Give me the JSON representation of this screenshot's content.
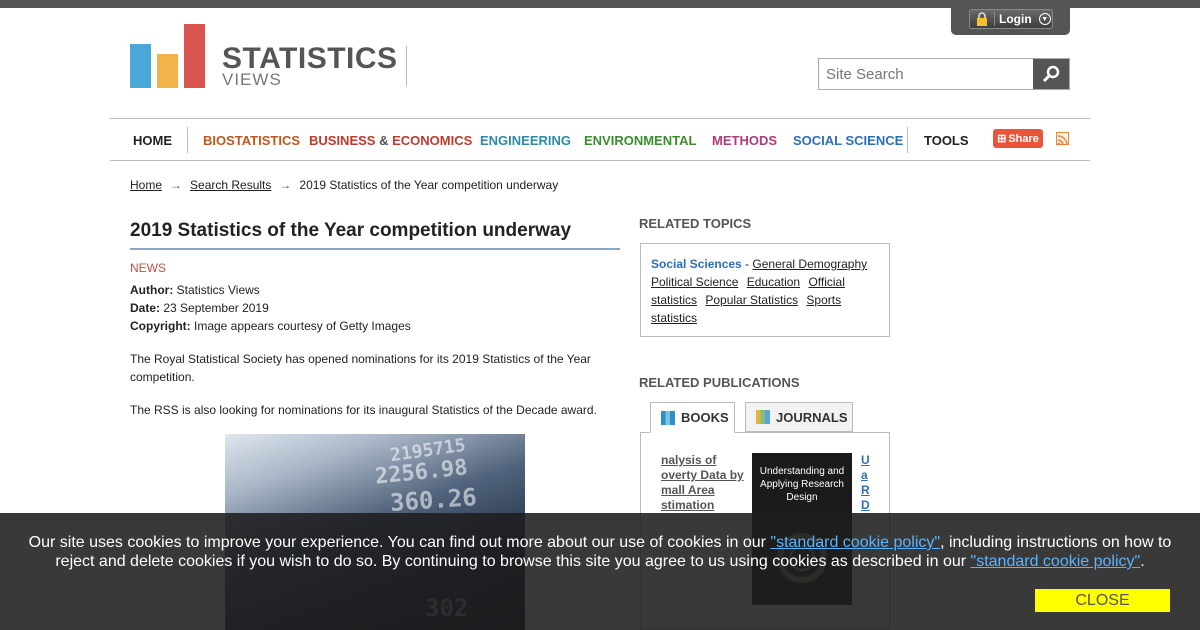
{
  "header": {
    "login_label": "Login",
    "logo_word1": "STATISTICS",
    "logo_word2": "VIEWS",
    "search_placeholder": "Site Search",
    "bar_colors": [
      "#4aa8d8",
      "#f2b34b",
      "#d9534f"
    ]
  },
  "nav": {
    "items": [
      {
        "label": "HOME",
        "color": "#222222"
      },
      {
        "label": "BIOSTATISTICS",
        "color": "#c0561e"
      },
      {
        "label": "BUSINESS",
        "color": "#c0392b"
      },
      {
        "label": "&",
        "color": "#555555"
      },
      {
        "label": "ECONOMICS",
        "color": "#c0392b"
      },
      {
        "label": "ENGINEERING",
        "color": "#2f8aa8"
      },
      {
        "label": "ENVIRONMENTAL",
        "color": "#3d8c2f"
      },
      {
        "label": "METHODS",
        "color": "#b03a7a"
      },
      {
        "label": "SOCIAL SCIENCE",
        "color": "#2d6fb5"
      },
      {
        "label": "TOOLS",
        "color": "#222222"
      }
    ],
    "share_label": "Share"
  },
  "breadcrumb": {
    "home": "Home",
    "search_results": "Search Results",
    "current": "2019 Statistics of the Year competition underway"
  },
  "article": {
    "title": "2019 Statistics of the Year competition underway",
    "category": "NEWS",
    "author_label": "Author:",
    "author": "Statistics Views",
    "date_label": "Date:",
    "date": "23 September 2019",
    "copyright_label": "Copyright:",
    "copyright": "Image appears courtesy of Getty Images",
    "para1": "The Royal Statistical Society has opened nominations for its 2019 Statistics of the Year competition.",
    "para2": "The RSS is also looking for nominations for its inaugural Statistics of the Decade award.",
    "image_numbers": [
      "2195715",
      "2256.98",
      "360.26",
      "302"
    ]
  },
  "sidebar": {
    "related_topics_heading": "RELATED TOPICS",
    "topics_lead": "Social Sciences",
    "topics": [
      "General Demography",
      "Political Science",
      "Education",
      "Official statistics",
      "Popular Statistics",
      "Sports statistics"
    ],
    "related_pubs_heading": "RELATED PUBLICATIONS",
    "tab_books": "BOOKS",
    "tab_journals": "JOURNALS",
    "pub1": "nalysis of overty Data by mall Area stimation",
    "pub_cover": "Understanding and Applying Research Design",
    "pub2": "U a R D"
  },
  "cookie": {
    "text1": "Our site uses cookies to improve your experience. You can find out more about our use of cookies in our ",
    "link": "\"standard cookie policy\"",
    "text2": ", including instructions on how to reject and delete cookies if you wish to do so. By continuing to browse this site you agree to us using cookies as described in our ",
    "text3": ".",
    "close_label": "CLOSE"
  }
}
